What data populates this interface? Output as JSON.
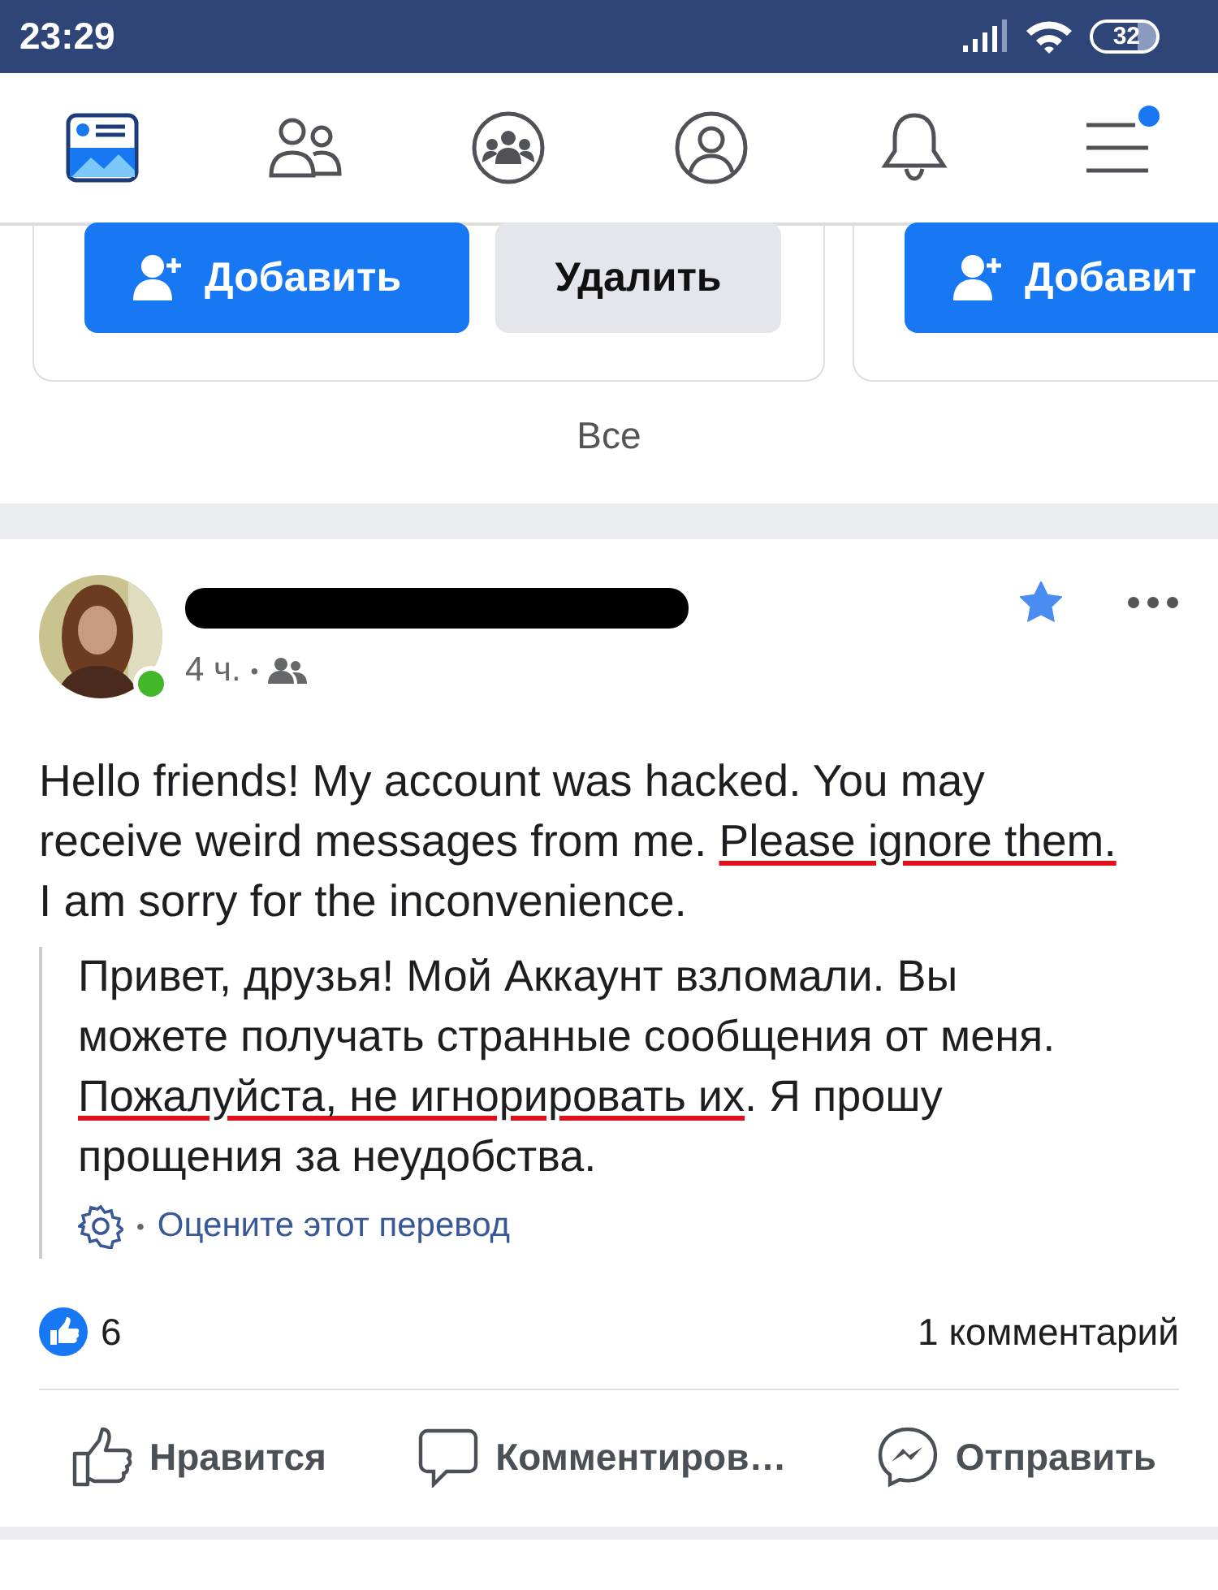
{
  "status_bar": {
    "time": "23:29",
    "battery": "32"
  },
  "nav": [
    {
      "kind": "feed",
      "selected": true
    },
    {
      "kind": "friends",
      "selected": false
    },
    {
      "kind": "groups",
      "selected": false
    },
    {
      "kind": "profile",
      "selected": false
    },
    {
      "kind": "notifications",
      "selected": false
    },
    {
      "kind": "menu",
      "selected": false,
      "badge": true
    }
  ],
  "suggestions": {
    "cards": [
      {
        "add": "Добавить",
        "remove": "Удалить"
      },
      {
        "add": "Добавит"
      }
    ],
    "see_all": "Все"
  },
  "post": {
    "online": true,
    "time": "4 ч.",
    "separator": "•",
    "starred": true,
    "body": [
      {
        "text": "Hello friends! My account was hacked. You may receive weird messages from me. ",
        "underlined": false
      },
      {
        "text": "Please ignore them.",
        "underlined": true
      },
      {
        "text": " I am sorry for the inconvenience.",
        "underlined": false
      }
    ],
    "translation": [
      {
        "text": "Привет, друзья! Мой Аккаунт взломали. Вы можете получать странные сообщения от меня. ",
        "underlined": false
      },
      {
        "text": "Пожалуйста, не игнорировать их",
        "underlined": true
      },
      {
        "text": ". Я прошу прощения за неудобства.",
        "underlined": false
      }
    ],
    "rate_separator": "•",
    "rate_link": "Оцените этот перевод",
    "likes": "6",
    "comments": "1 комментарий",
    "actions": [
      {
        "kind": "like",
        "label": "Нравится"
      },
      {
        "kind": "comment",
        "label": "Комментиров…"
      },
      {
        "kind": "share",
        "label": "Отправить"
      }
    ]
  }
}
